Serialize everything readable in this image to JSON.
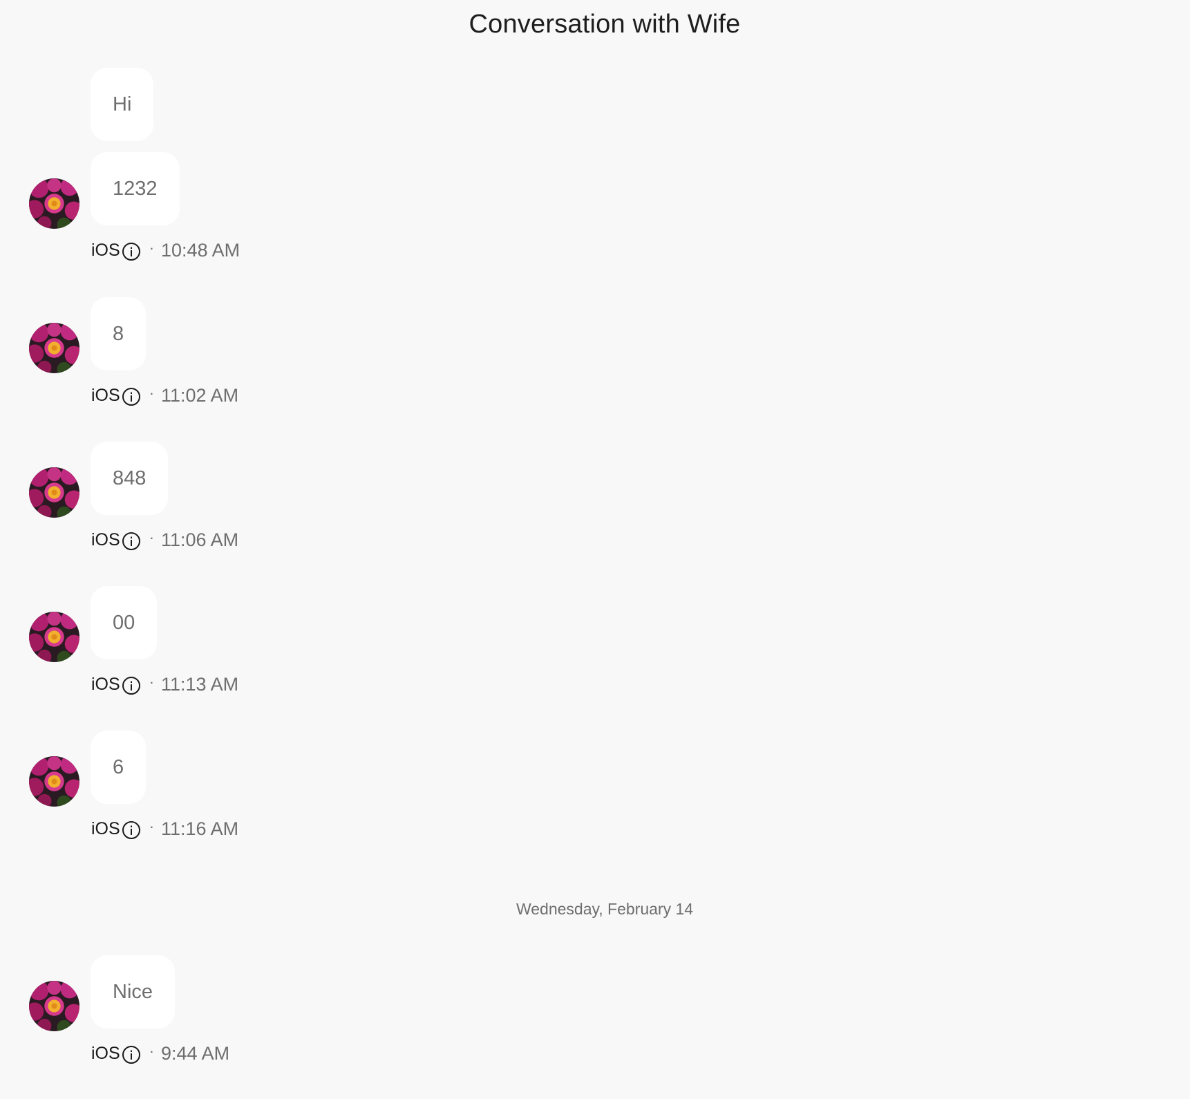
{
  "header": {
    "title": "Conversation with Wife"
  },
  "messages": [
    {
      "text": "Hi"
    },
    {
      "text": "1232",
      "platform": "iOS",
      "time": "10:48 AM"
    },
    {
      "text": "8",
      "platform": "iOS",
      "time": "11:02 AM"
    },
    {
      "text": "848",
      "platform": "iOS",
      "time": "11:06 AM"
    },
    {
      "text": "00",
      "platform": "iOS",
      "time": "11:13 AM"
    },
    {
      "text": "6",
      "platform": "iOS",
      "time": "11:16 AM"
    },
    {
      "text": "Nice",
      "platform": "iOS",
      "time": "9:44 AM"
    }
  ],
  "date_divider": {
    "label": "Wednesday, February 14"
  },
  "meta": {
    "separator": "·"
  },
  "icons": {
    "avatar": "flower-photo-avatar",
    "info": "info-circle-icon"
  },
  "colors": {
    "background": "#f8f8f8",
    "bubble": "#ffffff",
    "bubble_text": "#6e6e6e",
    "title_text": "#1e1e1e"
  }
}
